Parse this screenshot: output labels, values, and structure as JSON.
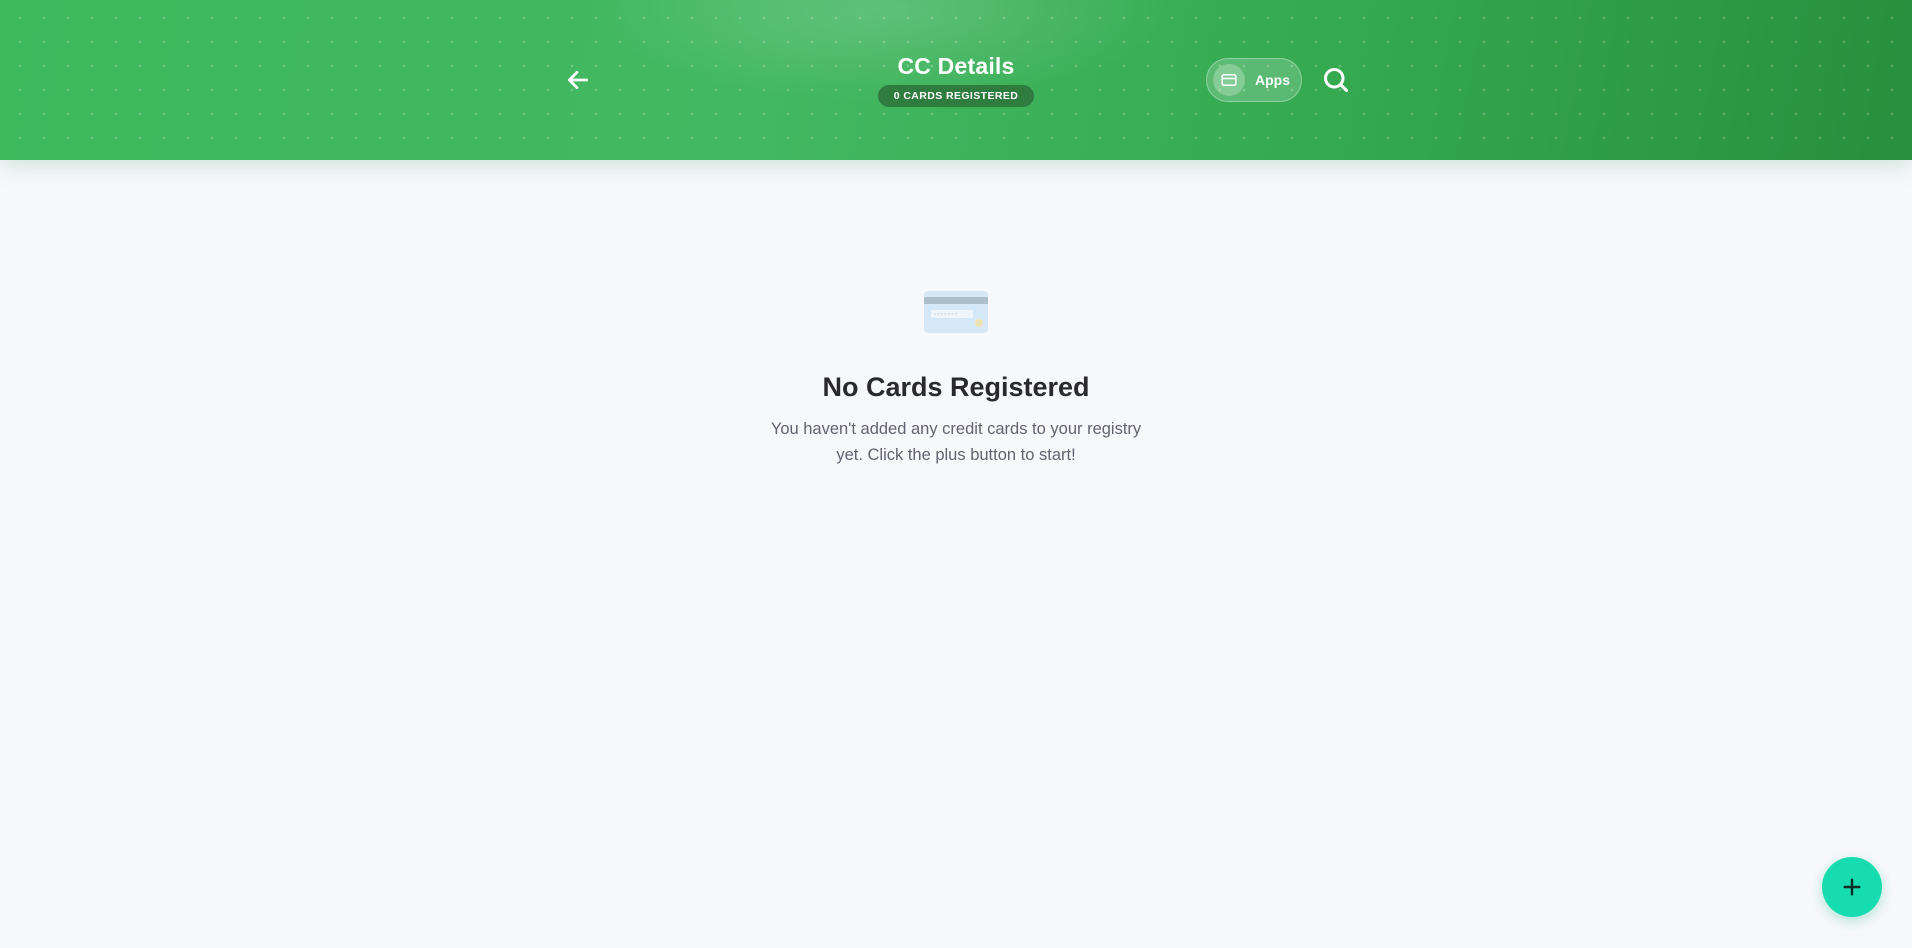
{
  "header": {
    "title": "CC Details",
    "count_badge": "0 CARDS REGISTERED",
    "apps_label": "Apps",
    "back_icon": "arrow-left-icon",
    "apps_icon": "credit-card-icon",
    "search_icon": "search-icon"
  },
  "empty_state": {
    "illustration_icon": "credit-card-illustration",
    "title": "No Cards Registered",
    "description": "You haven't added any credit cards to your registry yet. Click the plus button to start!"
  },
  "fab": {
    "icon": "plus-icon"
  },
  "colors": {
    "header_green": "#3cb95b",
    "badge_green": "#2e7d3e",
    "fab_teal": "#17dcb0",
    "background": "#f7f8fb"
  }
}
